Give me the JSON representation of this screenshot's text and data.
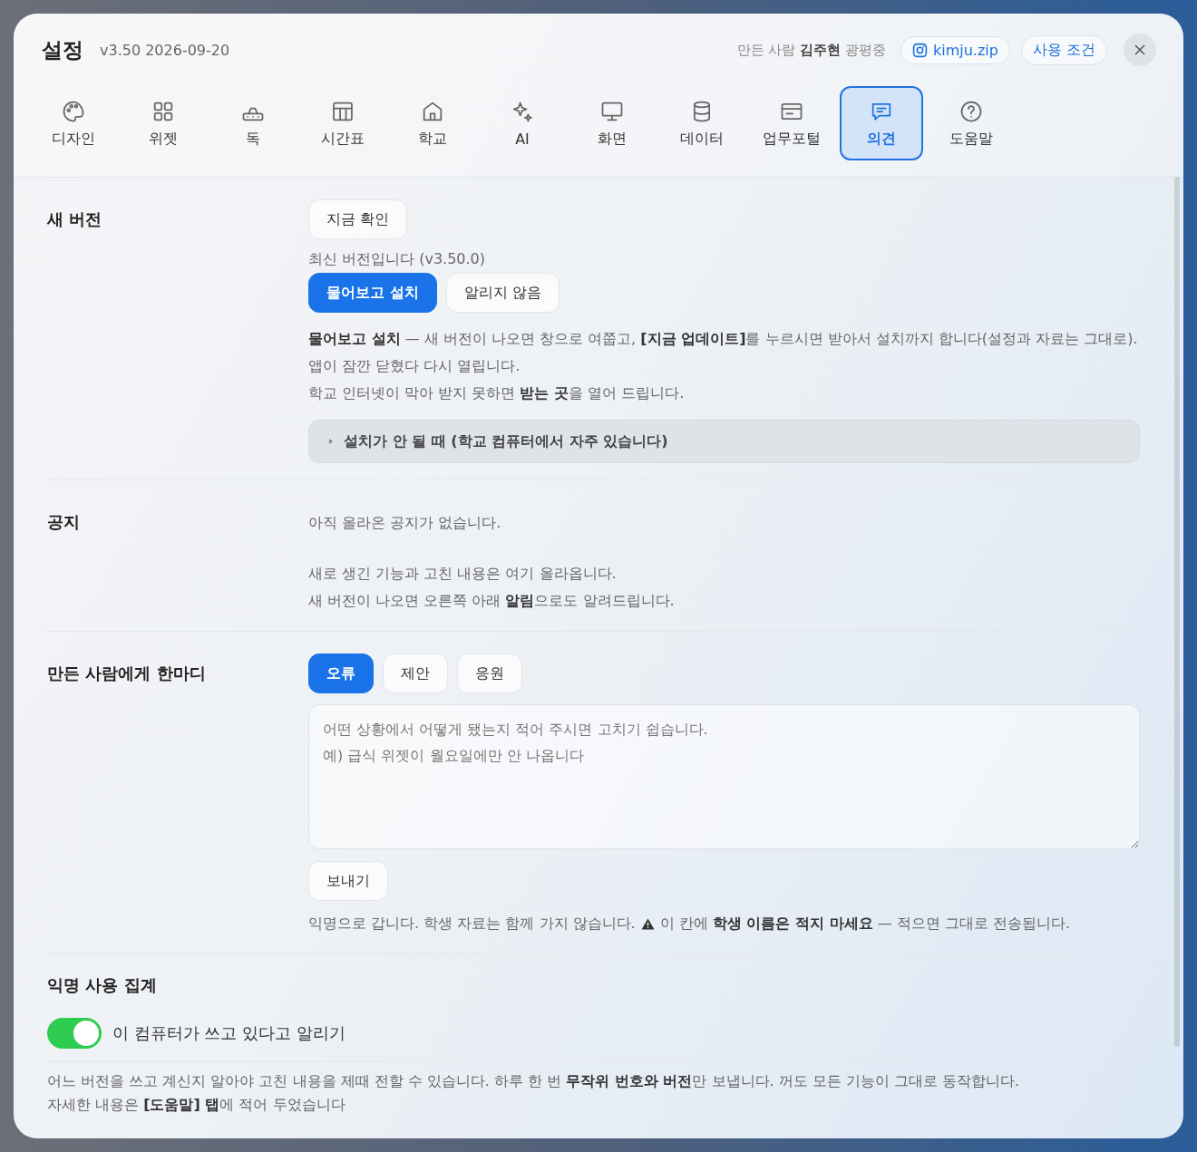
{
  "window": {
    "title": "설정",
    "version": "v3.50 2026-09-20"
  },
  "header": {
    "credit": "만든 사람 **김주현** 광평중",
    "instagram": "kimju.zip",
    "terms": "사용 조건"
  },
  "tabs": [
    {
      "label": "디자인",
      "selected": false
    },
    {
      "label": "위젯",
      "selected": false
    },
    {
      "label": "독",
      "selected": false
    },
    {
      "label": "시간표",
      "selected": false
    },
    {
      "label": "학교",
      "selected": false
    },
    {
      "label": "AI",
      "selected": false
    },
    {
      "label": "화면",
      "selected": false
    },
    {
      "label": "데이터",
      "selected": false
    },
    {
      "label": "업무포털",
      "selected": false
    },
    {
      "label": "의견",
      "selected": true
    },
    {
      "label": "도움말",
      "selected": false
    }
  ],
  "update": {
    "label": "새 버전",
    "check_button": "지금 확인",
    "status": "최신 버전입니다 (v3.50.0)",
    "modes": [
      {
        "label": "물어보고 설치",
        "selected": true
      },
      {
        "label": "알리지 않음",
        "selected": false
      }
    ],
    "description": [
      "**물어보고 설치** — 새 버전이 나오면 창으로 여쭙고, **[지금 업데이트]**를 누르시면 받아서 설치까지 합니다(설정과 자료는 그대로). 앱이 잠깐 닫혔다 다시 열립니다.",
      "학교 인터넷이 막아 받지 못하면 **받는 곳**을 열어 드립니다."
    ],
    "details": {
      "summary": "설치가 안 될 때 (학교 컴퓨터에서 자주 있습니다)",
      "expanded": false
    }
  },
  "notice": {
    "label": "공지",
    "empty": "아직 올라온 공지가 없습니다.",
    "info": [
      "새로 생긴 기능과 고친 내용은 여기 올라옵니다.",
      "새 버전이 나오면 오른쪽 아래 **알림**으로도 알려드립니다."
    ]
  },
  "feedback": {
    "label": "만든 사람에게 한마디",
    "categories": [
      {
        "label": "오류",
        "selected": true
      },
      {
        "label": "제안",
        "selected": false
      },
      {
        "label": "응원",
        "selected": false
      }
    ],
    "placeholder": "어떤 상황에서 어떻게 됐는지 적어 주시면 고치기 쉽습니다.\n예) 급식 위젯이 월요일에만 안 나옵니다",
    "send_button": "보내기",
    "note": "익명으로 갑니다. 학생 자료는 함께 가지 않습니다.",
    "warning": "이 칸에 **학생 이름은 적지 마세요** — 적으면 그대로 전송됩니다."
  },
  "telemetry": {
    "label": "익명 사용 집계",
    "toggle_label": "이 컴퓨터가 쓰고 있다고 알리기",
    "enabled": true,
    "description": [
      "어느 버전을 쓰고 계신지 알아야 고친 내용을 제때 전할 수 있습니다. 하루 한 번 **무작위 번호와 버전**만 보냅니다. 꺼도 모든 기능이 그대로 동작합니다.",
      "자세한 내용은 **[도움말] 탭**에 적어 두었습니다"
    ]
  }
}
